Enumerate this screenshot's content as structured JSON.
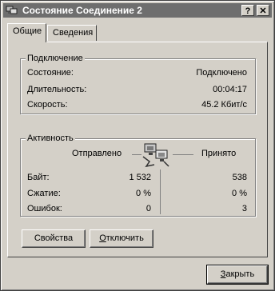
{
  "window": {
    "title": "Состояние Соединение 2"
  },
  "titlebar_buttons": {
    "help": "?",
    "close": "✕"
  },
  "tabs": [
    {
      "label": "Общие"
    },
    {
      "label": "Сведения"
    }
  ],
  "connection": {
    "legend": "Подключение",
    "rows": [
      {
        "label": "Состояние:",
        "value": "Подключено"
      },
      {
        "label": "Длительность:",
        "value": "00:04:17"
      },
      {
        "label": "Скорость:",
        "value": "45.2 Кбит/с"
      }
    ]
  },
  "activity": {
    "legend": "Активность",
    "sent_header": "Отправлено",
    "received_header": "Принято",
    "rows": [
      {
        "label": "Байт:",
        "sent": "1 532",
        "received": "538"
      },
      {
        "label": "Сжатие:",
        "sent": "0 %",
        "received": "0 %"
      },
      {
        "label": "Ошибок:",
        "sent": "0",
        "received": "3"
      }
    ],
    "icon": "network-computers-icon"
  },
  "buttons": {
    "properties": "Свойства",
    "disconnect_first": "О",
    "disconnect_rest": "тключить",
    "close_first": "З",
    "close_rest": "акрыть"
  }
}
